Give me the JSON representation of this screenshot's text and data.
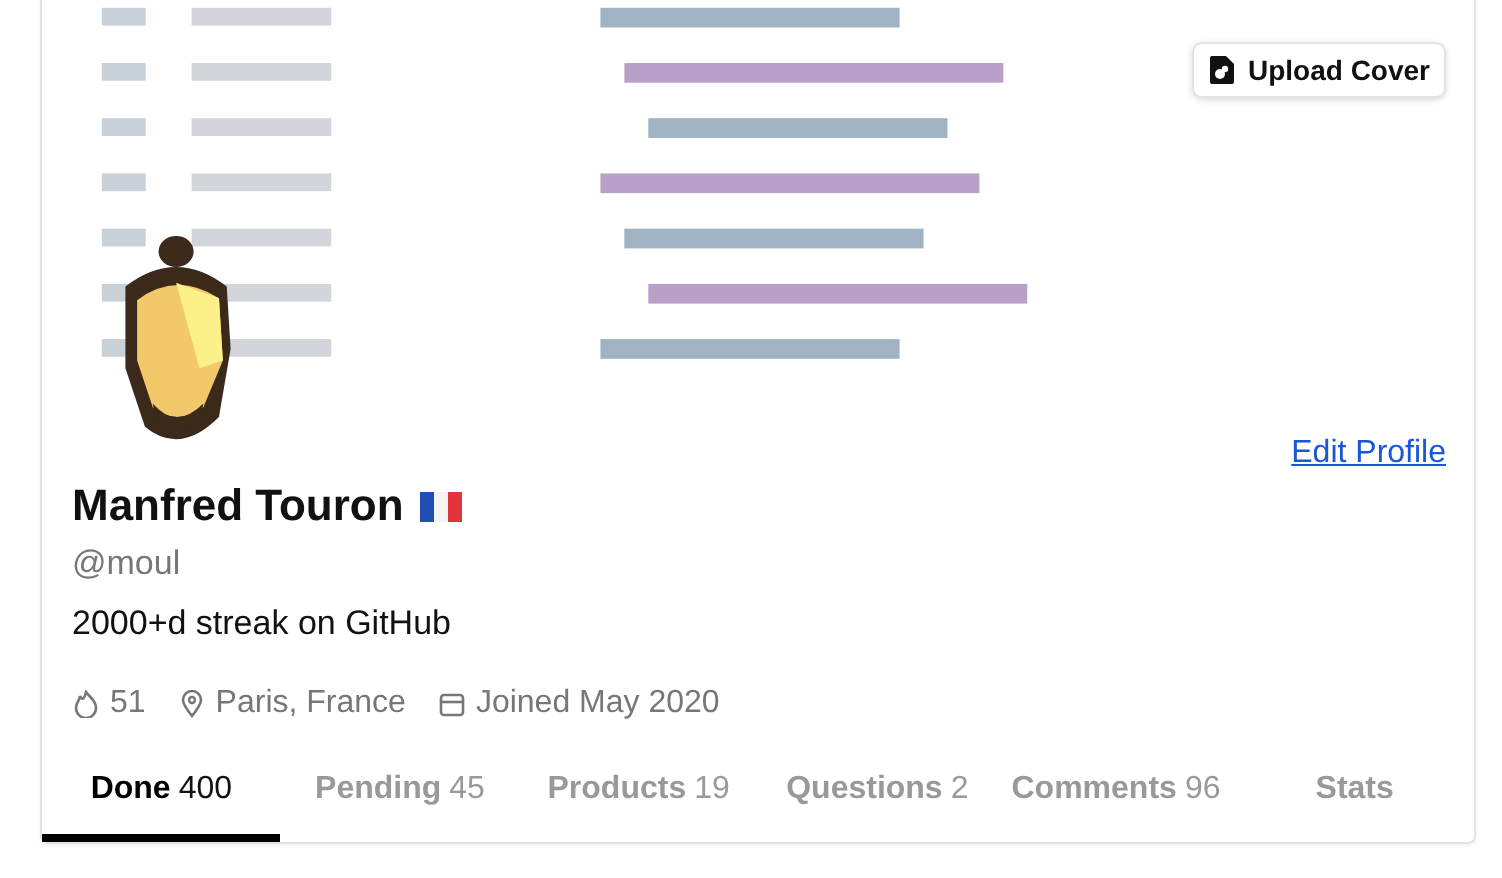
{
  "cover": {
    "kind": "picture",
    "upload_button": "Upload Cover"
  },
  "profile": {
    "name": "Manfred Touron",
    "handle": "@moul",
    "bio": "2000+d streak on GitHub",
    "edit_link": "Edit Profile",
    "meta": [
      {
        "kind": "streak",
        "text": "51"
      },
      {
        "kind": "location",
        "text": "Paris, France"
      },
      {
        "kind": "joined",
        "text": "Joined May 2020"
      }
    ]
  },
  "tabs": [
    {
      "label": "Done",
      "count": "400",
      "selected": true
    },
    {
      "label": "Pending",
      "count": "45",
      "selected": false
    },
    {
      "label": "Products",
      "count": "19",
      "selected": false
    },
    {
      "label": "Questions",
      "count": "2",
      "selected": false
    },
    {
      "label": "Comments",
      "count": "96",
      "selected": false
    },
    {
      "label": "Stats",
      "selected": false
    }
  ]
}
